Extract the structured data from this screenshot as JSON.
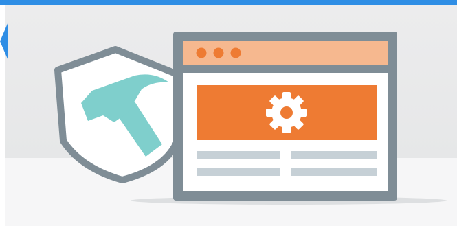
{
  "illustration": {
    "shield_icon": "shield-with-hammer-icon",
    "browser_icon": "browser-window-icon",
    "gear_icon": "gear-icon",
    "hammer_icon": "hammer-icon"
  },
  "navigation": {
    "back_icon": "chevron-left-icon"
  },
  "colors": {
    "top_bar": "#2f8ee5",
    "shield_outline": "#7f8d96",
    "hammer": "#7fcfcc",
    "browser_frame": "#7f8d96",
    "browser_titlebar": "#f6b88f",
    "browser_dots": "#ee7b33",
    "banner": "#ee7b33",
    "gear": "#ffffff",
    "content_lines": "#c6d0d6"
  }
}
